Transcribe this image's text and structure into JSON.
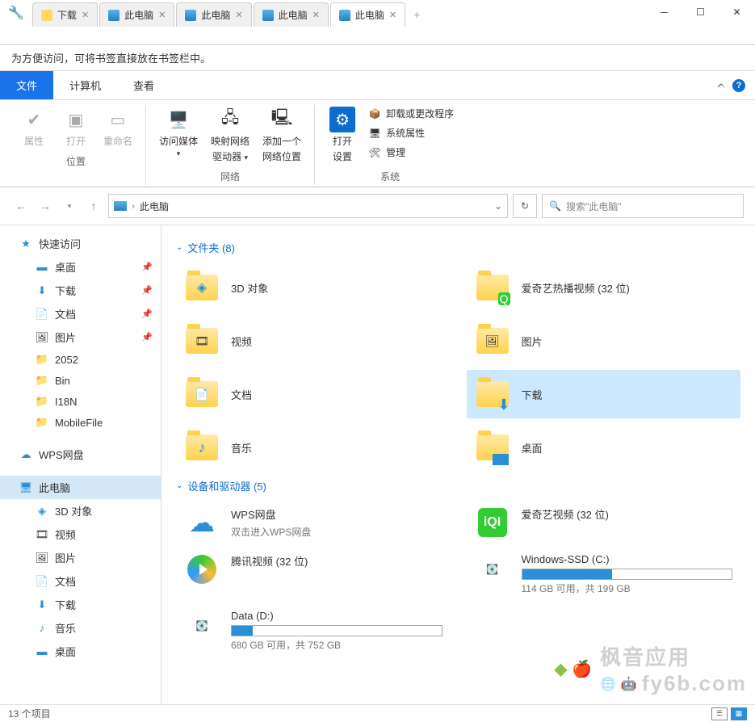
{
  "titlebar": {
    "tabs": [
      {
        "icon": "folder",
        "label": "下载"
      },
      {
        "icon": "pc",
        "label": "此电脑"
      },
      {
        "icon": "pc",
        "label": "此电脑"
      },
      {
        "icon": "pc",
        "label": "此电脑"
      },
      {
        "icon": "pc",
        "label": "此电脑",
        "active": true
      }
    ]
  },
  "hint": "为方便访问，可将书签直接放在书签栏中。",
  "menu": {
    "file": "文件",
    "computer": "计算机",
    "view": "查看"
  },
  "ribbon": {
    "group1_label": "位置",
    "properties": "属性",
    "open": "打开",
    "rename": "重命名",
    "group2_label": "网络",
    "media": "访问媒体",
    "mapdrive1": "映射网络",
    "mapdrive2": "驱动器",
    "addnet1": "添加一个",
    "addnet2": "网络位置",
    "group3_label": "系统",
    "opensettings1": "打开",
    "opensettings2": "设置",
    "uninstall": "卸载或更改程序",
    "sysprops": "系统属性",
    "manage": "管理"
  },
  "breadcrumb": {
    "text": "此电脑"
  },
  "search": {
    "placeholder": "搜索\"此电脑\""
  },
  "sidebar": {
    "quickaccess": "快速访问",
    "desktop": "桌面",
    "downloads": "下载",
    "documents": "文档",
    "pictures": "图片",
    "f2052": "2052",
    "bin": "Bin",
    "i18n": "I18N",
    "mobilefile": "MobileFile",
    "wps": "WPS网盘",
    "thispc": "此电脑",
    "objects3d": "3D 对象",
    "video": "视频",
    "pictures2": "图片",
    "documents2": "文档",
    "downloads2": "下载",
    "music": "音乐",
    "desktop2": "桌面"
  },
  "content": {
    "section1": "文件夹 (8)",
    "section2": "设备和驱动器 (5)",
    "folders": {
      "objects3d": "3D 对象",
      "iqiyi_hot": "爱奇艺热播视频 (32 位)",
      "video": "视频",
      "pictures": "图片",
      "documents": "文档",
      "downloads": "下载",
      "music": "音乐",
      "desktop": "桌面"
    },
    "devices": {
      "wps_name": "WPS网盘",
      "wps_sub": "双击进入WPS网盘",
      "iqiyi": "爱奇艺视频 (32 位)",
      "tencent": "腾讯视频 (32 位)",
      "ssd_name": "Windows-SSD (C:)",
      "ssd_text": "114 GB 可用，共 199 GB",
      "data_name": "Data (D:)",
      "data_text": "680 GB 可用，共 752 GB"
    }
  },
  "statusbar": {
    "text": "13 个项目"
  },
  "watermark": {
    "text1": "枫音应用",
    "text2": "fy6b.com"
  }
}
